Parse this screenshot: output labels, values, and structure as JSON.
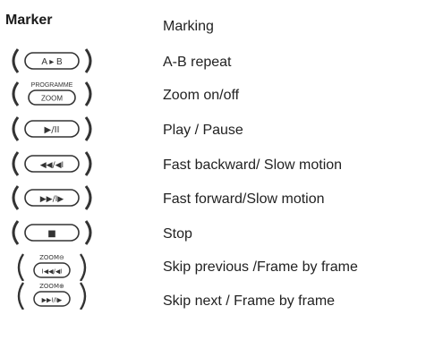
{
  "legend": {
    "header": "Marker",
    "header_desc": "Marking",
    "items": [
      {
        "icon": "ab-repeat-icon",
        "button_text": "A ▸ B",
        "top_text": "",
        "description": "A-B repeat"
      },
      {
        "icon": "zoom-icon",
        "button_text": "ZOOM",
        "top_text": "PROGRAMME",
        "description": "Zoom on/off"
      },
      {
        "icon": "play-pause-icon",
        "button_text": "▶/II",
        "top_text": "",
        "description": "Play / Pause"
      },
      {
        "icon": "fast-backward-icon",
        "button_text": "◀◀/◀I",
        "top_text": "",
        "description": "Fast backward/ Slow motion"
      },
      {
        "icon": "fast-forward-icon",
        "button_text": "▶▶/I▶",
        "top_text": "",
        "description": "Fast forward/Slow motion"
      },
      {
        "icon": "stop-icon",
        "button_text": "■",
        "top_text": "",
        "description": "Stop"
      },
      {
        "icon": "skip-previous-icon",
        "button_text": "I◀◀/◀I",
        "top_text": "ZOOM⊖",
        "description": "Skip previous /Frame by frame"
      },
      {
        "icon": "skip-next-icon",
        "button_text": "▶▶I/I▶",
        "top_text": "ZOOM⊕",
        "description": "Skip next / Frame by frame"
      }
    ]
  },
  "colors": {
    "ink": "#222222",
    "stroke": "#333333"
  }
}
